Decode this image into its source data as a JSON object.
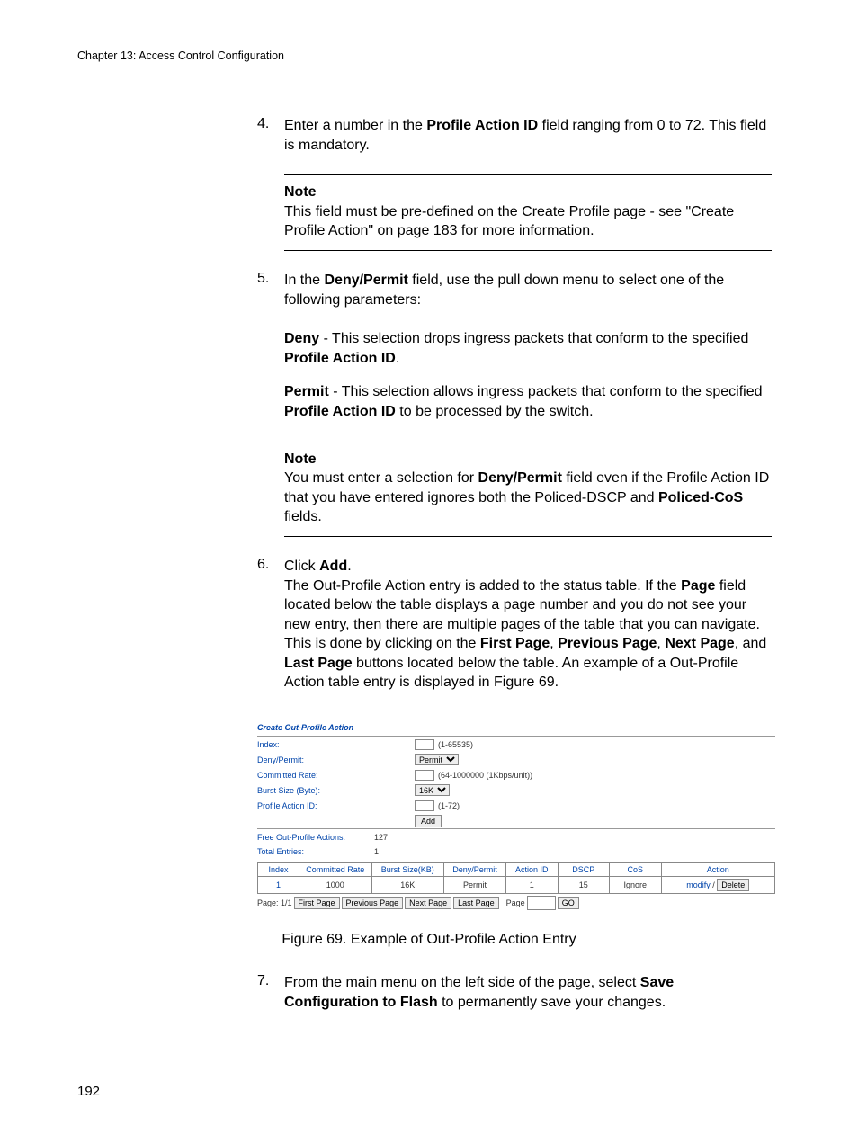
{
  "header": {
    "chapter": "Chapter 13: Access Control Configuration"
  },
  "step4": {
    "marker": "4.",
    "text_1": "Enter a number in the ",
    "bold_1": "Profile Action ID",
    "text_2": " field ranging from 0 to 72. This field is mandatory."
  },
  "note1": {
    "title": "Note",
    "body": "This field must be pre-defined on the Create Profile page - see \"Create Profile Action\" on page 183 for more information."
  },
  "step5": {
    "marker": "5.",
    "text_1": "In the ",
    "bold_1": "Deny/Permit",
    "text_2": " field, use the pull down menu to select one of the following parameters:"
  },
  "deny_para": {
    "bold_1": "Deny",
    "text_1": " - This selection drops ingress packets that conform to the specified ",
    "bold_2": "Profile Action ID",
    "text_2": "."
  },
  "permit_para": {
    "bold_1": "Permit",
    "text_1": " - This selection allows ingress packets that conform to the specified ",
    "bold_2": "Profile Action ID",
    "text_2": " to be processed by the switch."
  },
  "note2": {
    "title": "Note",
    "body_1": "You must enter a selection for ",
    "bold_1": "Deny/Permit",
    "body_2": " field even if the Profile Action ID that you have entered ignores both the Policed-DSCP and ",
    "bold_2": "Policed-CoS",
    "body_3": " fields."
  },
  "step6": {
    "marker": "6.",
    "text_1": "Click ",
    "bold_1": "Add",
    "text_2": ".",
    "body_1": "The Out-Profile Action entry is added to the status table. If the ",
    "bold_2": "Page",
    "body_2": " field located below the table displays a page number and you do not see your new entry, then there are multiple pages of the table that you can navigate. This is done by clicking on the ",
    "bold_3": "First Page",
    "body_3": ", ",
    "bold_4": "Previous Page",
    "body_4": ", ",
    "bold_5": "Next Page",
    "body_5": ", and ",
    "bold_6": "Last Page",
    "body_6": " buttons located below the table. An example of a Out-Profile Action table entry is displayed in Figure 69."
  },
  "screenshot": {
    "title": "Create Out-Profile Action",
    "labels": {
      "index": "Index:",
      "deny_permit": "Deny/Permit:",
      "committed_rate": "Committed Rate:",
      "burst_size": "Burst Size (Byte):",
      "profile_action_id": "Profile Action ID:"
    },
    "hints": {
      "index": "(1-65535)",
      "committed_rate": "(64-1000000 (1Kbps/unit))",
      "profile_action_id": "(1-72)"
    },
    "select_permit": "Permit",
    "select_burst": "16K",
    "add_btn": "Add",
    "free_label": "Free Out-Profile Actions:",
    "free_val": "127",
    "total_label": "Total Entries:",
    "total_val": "1",
    "table": {
      "headers": [
        "Index",
        "Committed Rate",
        "Burst Size(KB)",
        "Deny/Permit",
        "Action ID",
        "DSCP",
        "CoS",
        "Action"
      ],
      "row": {
        "index": "1",
        "rate": "1000",
        "burst": "16K",
        "dp": "Permit",
        "aid": "1",
        "dscp": "15",
        "cos": "Ignore",
        "modify": "modify",
        "sep": " / ",
        "delete": "Delete"
      }
    },
    "pager": {
      "page_label": "Page: 1/1",
      "first": "First Page",
      "prev": "Previous Page",
      "next": "Next Page",
      "last": "Last Page",
      "page_text": "Page",
      "go": "GO"
    }
  },
  "fig_caption": "Figure 69. Example of Out-Profile Action Entry",
  "step7": {
    "marker": "7.",
    "text_1": "From the main menu on the left side of the page, select ",
    "bold_1": "Save Configuration to Flash",
    "text_2": " to permanently save your changes."
  },
  "page_number": "192"
}
